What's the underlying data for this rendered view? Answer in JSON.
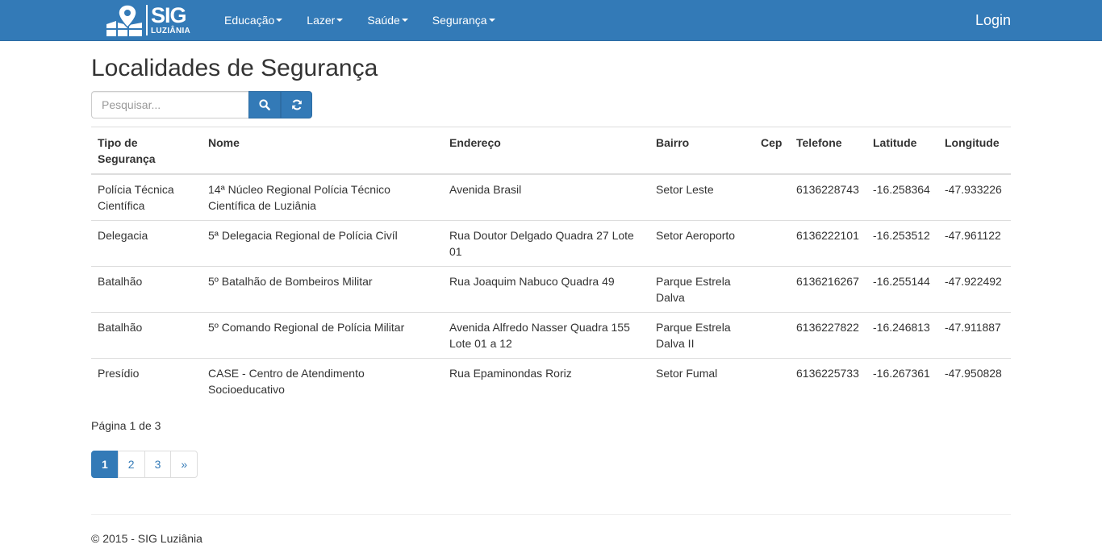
{
  "brand": {
    "name": "SIG",
    "city": "LUZIÂNIA"
  },
  "nav": {
    "menus": [
      {
        "label": "Educação"
      },
      {
        "label": "Lazer"
      },
      {
        "label": "Saúde"
      },
      {
        "label": "Segurança"
      }
    ],
    "login_label": "Login"
  },
  "page": {
    "title": "Localidades de Segurança"
  },
  "search": {
    "placeholder": "Pesquisar...",
    "value": "",
    "search_icon": "search-icon",
    "refresh_icon": "refresh-icon"
  },
  "table": {
    "headers": [
      "Tipo de Segurança",
      "Nome",
      "Endereço",
      "Bairro",
      "Cep",
      "Telefone",
      "Latitude",
      "Longitude"
    ],
    "rows": [
      {
        "tipo": "Polícia Técnica Científica",
        "nome": "14ª Núcleo Regional Polícia Técnico Científica de Luziânia",
        "endereco": "Avenida Brasil",
        "bairro": "Setor Leste",
        "cep": "",
        "telefone": "6136228743",
        "latitude": "-16.258364",
        "longitude": "-47.933226"
      },
      {
        "tipo": "Delegacia",
        "nome": "5ª Delegacia Regional de Polícia Civíl",
        "endereco": "Rua Doutor Delgado Quadra 27 Lote 01",
        "bairro": "Setor Aeroporto",
        "cep": "",
        "telefone": "6136222101",
        "latitude": "-16.253512",
        "longitude": "-47.961122"
      },
      {
        "tipo": "Batalhão",
        "nome": "5º Batalhão de Bombeiros Militar",
        "endereco": "Rua Joaquim Nabuco Quadra 49",
        "bairro": "Parque Estrela Dalva",
        "cep": "",
        "telefone": "6136216267",
        "latitude": "-16.255144",
        "longitude": "-47.922492"
      },
      {
        "tipo": "Batalhão",
        "nome": "5º Comando Regional de Polícia Militar",
        "endereco": "Avenida Alfredo Nasser Quadra 155 Lote 01 a 12",
        "bairro": "Parque Estrela Dalva II",
        "cep": "",
        "telefone": "6136227822",
        "latitude": "-16.246813",
        "longitude": "-47.911887"
      },
      {
        "tipo": "Presídio",
        "nome": "CASE - Centro de Atendimento Socioeducativo",
        "endereco": "Rua Epaminondas Roriz",
        "bairro": "Setor Fumal",
        "cep": "",
        "telefone": "6136225733",
        "latitude": "-16.267361",
        "longitude": "-47.950828"
      }
    ]
  },
  "pagination": {
    "info": "Página 1 de 3",
    "pages": [
      "1",
      "2",
      "3"
    ],
    "next_label": "»",
    "active_page": "1"
  },
  "footer": {
    "text": "© 2015 - SIG Luziânia"
  },
  "colors": {
    "primary": "#337ab7",
    "border": "#dddddd",
    "text": "#333333"
  }
}
